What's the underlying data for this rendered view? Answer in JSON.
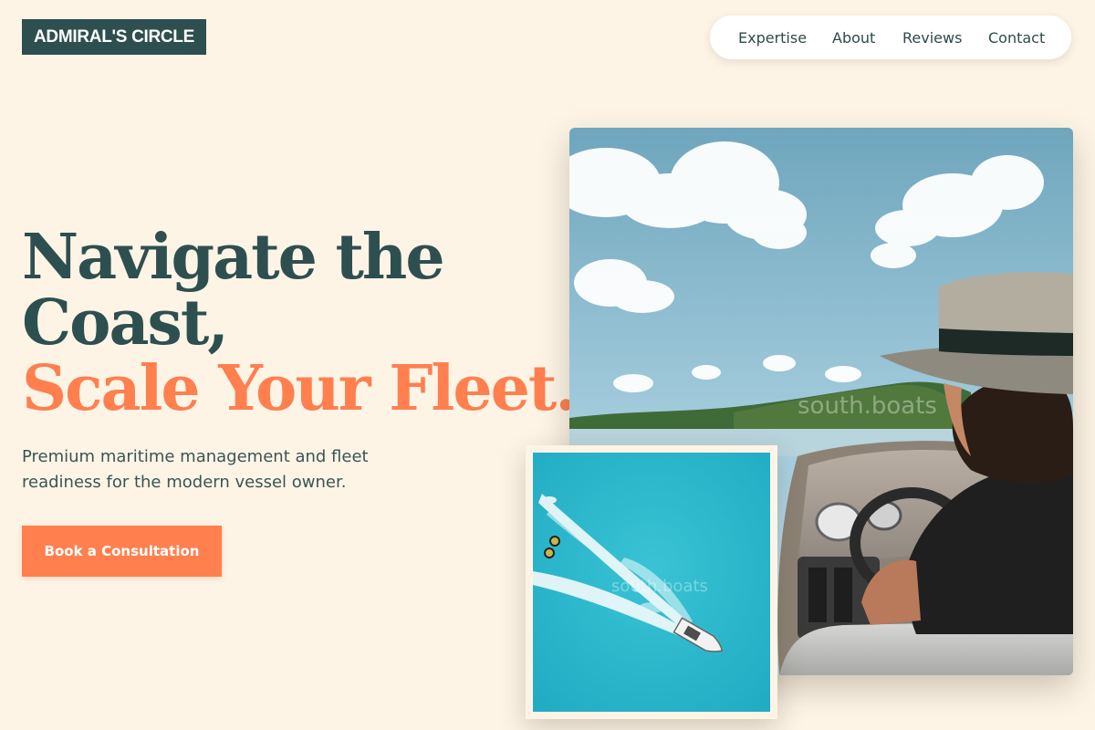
{
  "brand": {
    "logo_text": "ADMIRAL'S CIRCLE"
  },
  "nav": {
    "items": [
      {
        "label": "Expertise"
      },
      {
        "label": "About"
      },
      {
        "label": "Reviews"
      },
      {
        "label": "Contact"
      }
    ]
  },
  "hero": {
    "headline_line1": "Navigate the",
    "headline_line2": "Coast,",
    "headline_accent": "Scale Your Fleet.",
    "subtitle": "Premium maritime management and fleet readiness for the modern vessel owner.",
    "cta_label": "Book a Consultation"
  },
  "images": {
    "main_watermark": "south.boats",
    "inset_watermark": "south.boats"
  },
  "colors": {
    "background": "#fdf4e6",
    "primary": "#2e4f4f",
    "accent": "#ff7f4f"
  }
}
